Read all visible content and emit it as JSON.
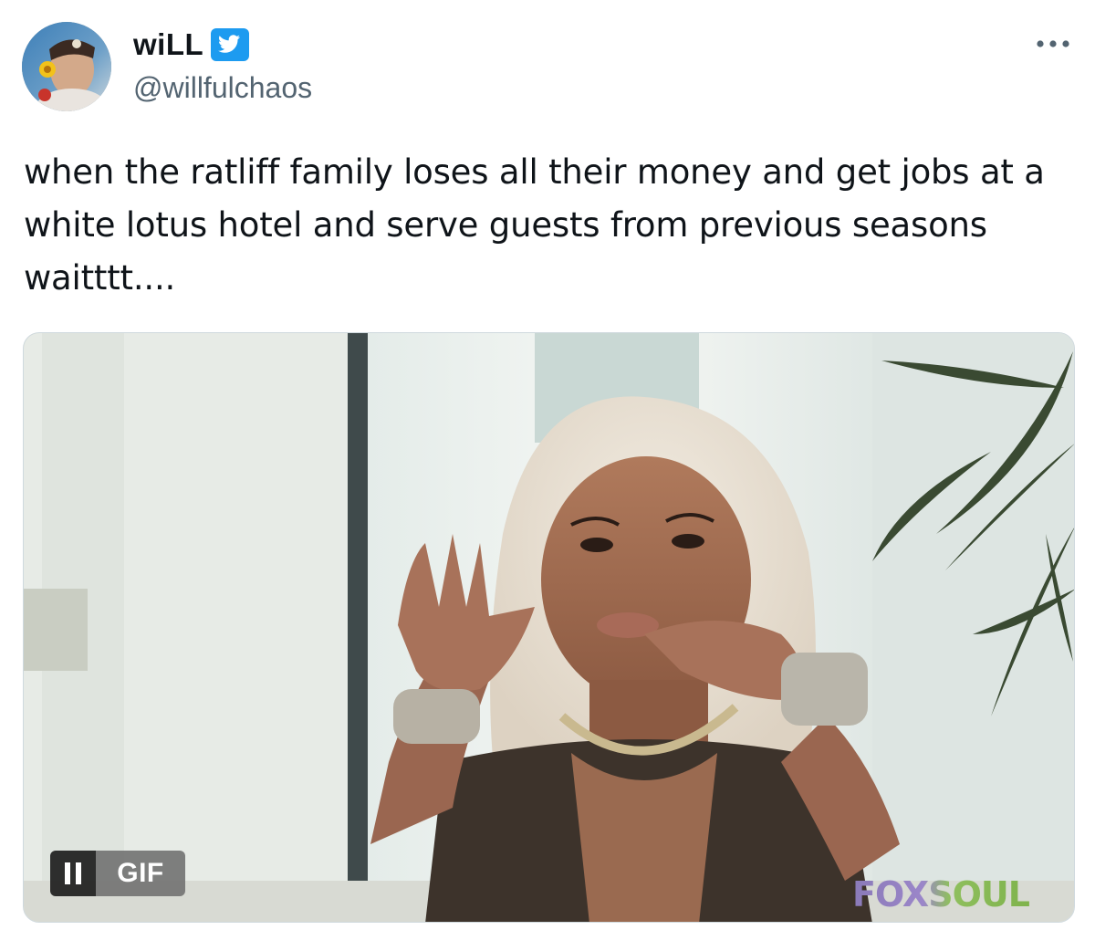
{
  "tweet": {
    "author": {
      "display_name": "wiLL",
      "handle": "@willfulchaos",
      "avatar_icon": "profile-photo",
      "verified_icon": "twitter-bird-verified-badge",
      "verified_color": "#1d9bf0"
    },
    "more_icon": "more-horizontal-icon",
    "text": "when the ratliff family loses all their money and get jobs at a white lotus hotel and serve guests from previous seasons waitttt....",
    "media": {
      "type": "gif",
      "pause_icon": "pause-icon",
      "badge_label": "GIF",
      "watermark": "FOXSOUL"
    }
  },
  "colors": {
    "text_primary": "#0f1419",
    "text_secondary": "#536471",
    "border": "#cfd9de",
    "accent": "#1d9bf0"
  }
}
